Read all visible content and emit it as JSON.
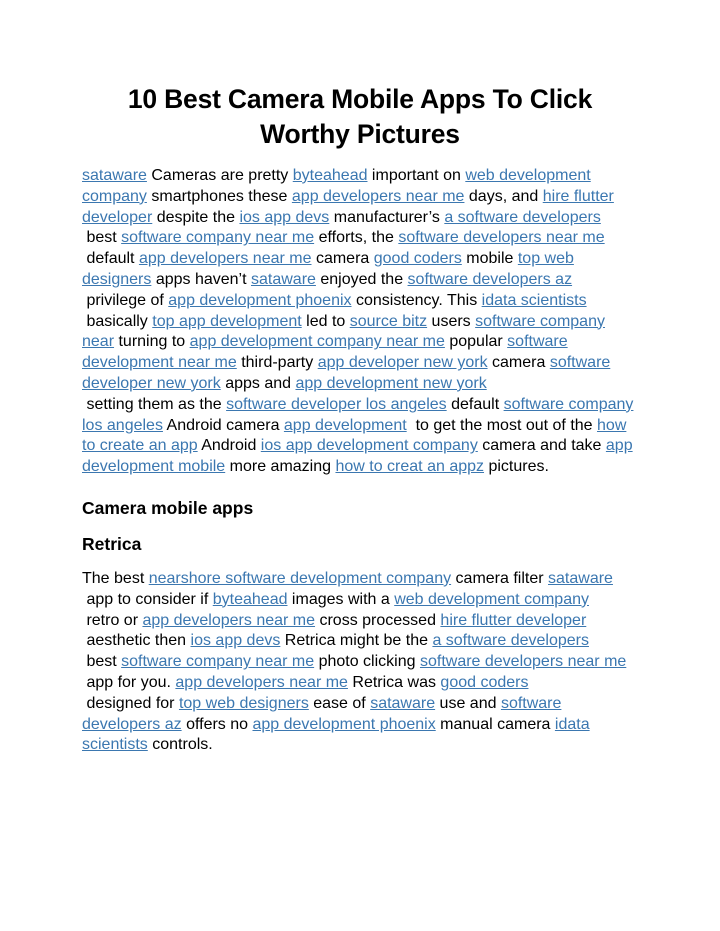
{
  "document": {
    "title": "10 Best Camera Mobile Apps To Click Worthy Pictures",
    "link_color": "#3b77b0",
    "text_color": "#000000",
    "background_color": "#ffffff"
  },
  "paragraph1": {
    "runs": [
      {
        "t": "link",
        "v": "sataware"
      },
      {
        "t": "text",
        "v": " Cameras are pretty "
      },
      {
        "t": "link",
        "v": "byteahead"
      },
      {
        "t": "text",
        "v": " important on "
      },
      {
        "t": "link",
        "v": "web development company"
      },
      {
        "t": "text",
        "v": " smartphones these "
      },
      {
        "t": "link",
        "v": "app developers near me"
      },
      {
        "t": "text",
        "v": " days, and "
      },
      {
        "t": "link",
        "v": "hire flutter developer"
      },
      {
        "t": "text",
        "v": " despite the "
      },
      {
        "t": "link",
        "v": "ios app devs"
      },
      {
        "t": "text",
        "v": " manufacturer’s "
      },
      {
        "t": "link",
        "v": "a software developers"
      },
      {
        "t": "text",
        "v": " best "
      },
      {
        "t": "link",
        "v": "software company near me"
      },
      {
        "t": "text",
        "v": " efforts, the "
      },
      {
        "t": "link",
        "v": "software developers near me"
      },
      {
        "t": "text",
        "v": " default "
      },
      {
        "t": "link",
        "v": "app developers near me"
      },
      {
        "t": "text",
        "v": " camera "
      },
      {
        "t": "link",
        "v": "good coders"
      },
      {
        "t": "text",
        "v": " mobile "
      },
      {
        "t": "link",
        "v": "top web designers"
      },
      {
        "t": "text",
        "v": " apps haven’t "
      },
      {
        "t": "link",
        "v": "sataware"
      },
      {
        "t": "text",
        "v": " enjoyed the "
      },
      {
        "t": "link",
        "v": "software developers az"
      },
      {
        "t": "text",
        "v": " privilege of "
      },
      {
        "t": "link",
        "v": "app development phoenix"
      },
      {
        "t": "text",
        "v": " consistency. This "
      },
      {
        "t": "link",
        "v": "idata scientists"
      },
      {
        "t": "text",
        "v": " basically "
      },
      {
        "t": "link",
        "v": "top app development"
      },
      {
        "t": "text",
        "v": " led to "
      },
      {
        "t": "link",
        "v": "source bitz"
      },
      {
        "t": "text",
        "v": " users "
      },
      {
        "t": "link",
        "v": "software company near"
      },
      {
        "t": "text",
        "v": " turning to "
      },
      {
        "t": "link",
        "v": "app development company near me"
      },
      {
        "t": "text",
        "v": " popular "
      },
      {
        "t": "link",
        "v": "software development near me"
      },
      {
        "t": "text",
        "v": " third-party "
      },
      {
        "t": "link",
        "v": "app developer new york"
      },
      {
        "t": "text",
        "v": " camera "
      },
      {
        "t": "link",
        "v": "software developer new york"
      },
      {
        "t": "text",
        "v": " apps and "
      },
      {
        "t": "link",
        "v": "app development new york"
      },
      {
        "t": "text",
        "v": " setting them as the "
      },
      {
        "t": "link",
        "v": "software developer los angeles"
      },
      {
        "t": "text",
        "v": " default "
      },
      {
        "t": "link",
        "v": "software company los angeles"
      },
      {
        "t": "text",
        "v": " Android camera "
      },
      {
        "t": "link",
        "v": "app development"
      },
      {
        "t": "text",
        "v": "  to get the most out of the "
      },
      {
        "t": "link",
        "v": "how to create an app"
      },
      {
        "t": "text",
        "v": " Android "
      },
      {
        "t": "link",
        "v": "ios app development company"
      },
      {
        "t": "text",
        "v": " camera and take "
      },
      {
        "t": "link",
        "v": "app development mobile"
      },
      {
        "t": "text",
        "v": " more amazing "
      },
      {
        "t": "link",
        "v": "how to creat an appz"
      },
      {
        "t": "text",
        "v": " pictures."
      }
    ]
  },
  "heading_camera_mobile_apps": "Camera mobile apps",
  "heading_retrica": "Retrica",
  "paragraph2": {
    "runs": [
      {
        "t": "text",
        "v": "The best "
      },
      {
        "t": "link",
        "v": "nearshore software development company"
      },
      {
        "t": "text",
        "v": " camera filter "
      },
      {
        "t": "link",
        "v": "sataware"
      },
      {
        "t": "text",
        "v": " app to consider if "
      },
      {
        "t": "link",
        "v": "byteahead"
      },
      {
        "t": "text",
        "v": " images with a "
      },
      {
        "t": "link",
        "v": "web development company"
      },
      {
        "t": "text",
        "v": " retro or "
      },
      {
        "t": "link",
        "v": "app developers near me"
      },
      {
        "t": "text",
        "v": " cross processed "
      },
      {
        "t": "link",
        "v": "hire flutter developer"
      },
      {
        "t": "text",
        "v": " aesthetic then "
      },
      {
        "t": "link",
        "v": "ios app devs"
      },
      {
        "t": "text",
        "v": " Retrica might be the "
      },
      {
        "t": "link",
        "v": "a software developers"
      },
      {
        "t": "text",
        "v": " best "
      },
      {
        "t": "link",
        "v": "software company near me"
      },
      {
        "t": "text",
        "v": " photo clicking "
      },
      {
        "t": "link",
        "v": "software developers near me"
      },
      {
        "t": "text",
        "v": " app for you. "
      },
      {
        "t": "link",
        "v": "app developers near me"
      },
      {
        "t": "text",
        "v": " Retrica was "
      },
      {
        "t": "link",
        "v": "good coders"
      },
      {
        "t": "text",
        "v": " designed for "
      },
      {
        "t": "link",
        "v": "top web designers"
      },
      {
        "t": "text",
        "v": " ease of "
      },
      {
        "t": "link",
        "v": "sataware"
      },
      {
        "t": "text",
        "v": " use and "
      },
      {
        "t": "link",
        "v": "software developers az"
      },
      {
        "t": "text",
        "v": " offers no "
      },
      {
        "t": "link",
        "v": "app development phoenix"
      },
      {
        "t": "text",
        "v": " manual camera "
      },
      {
        "t": "link",
        "v": "idata scientists"
      },
      {
        "t": "text",
        "v": " controls."
      }
    ]
  }
}
